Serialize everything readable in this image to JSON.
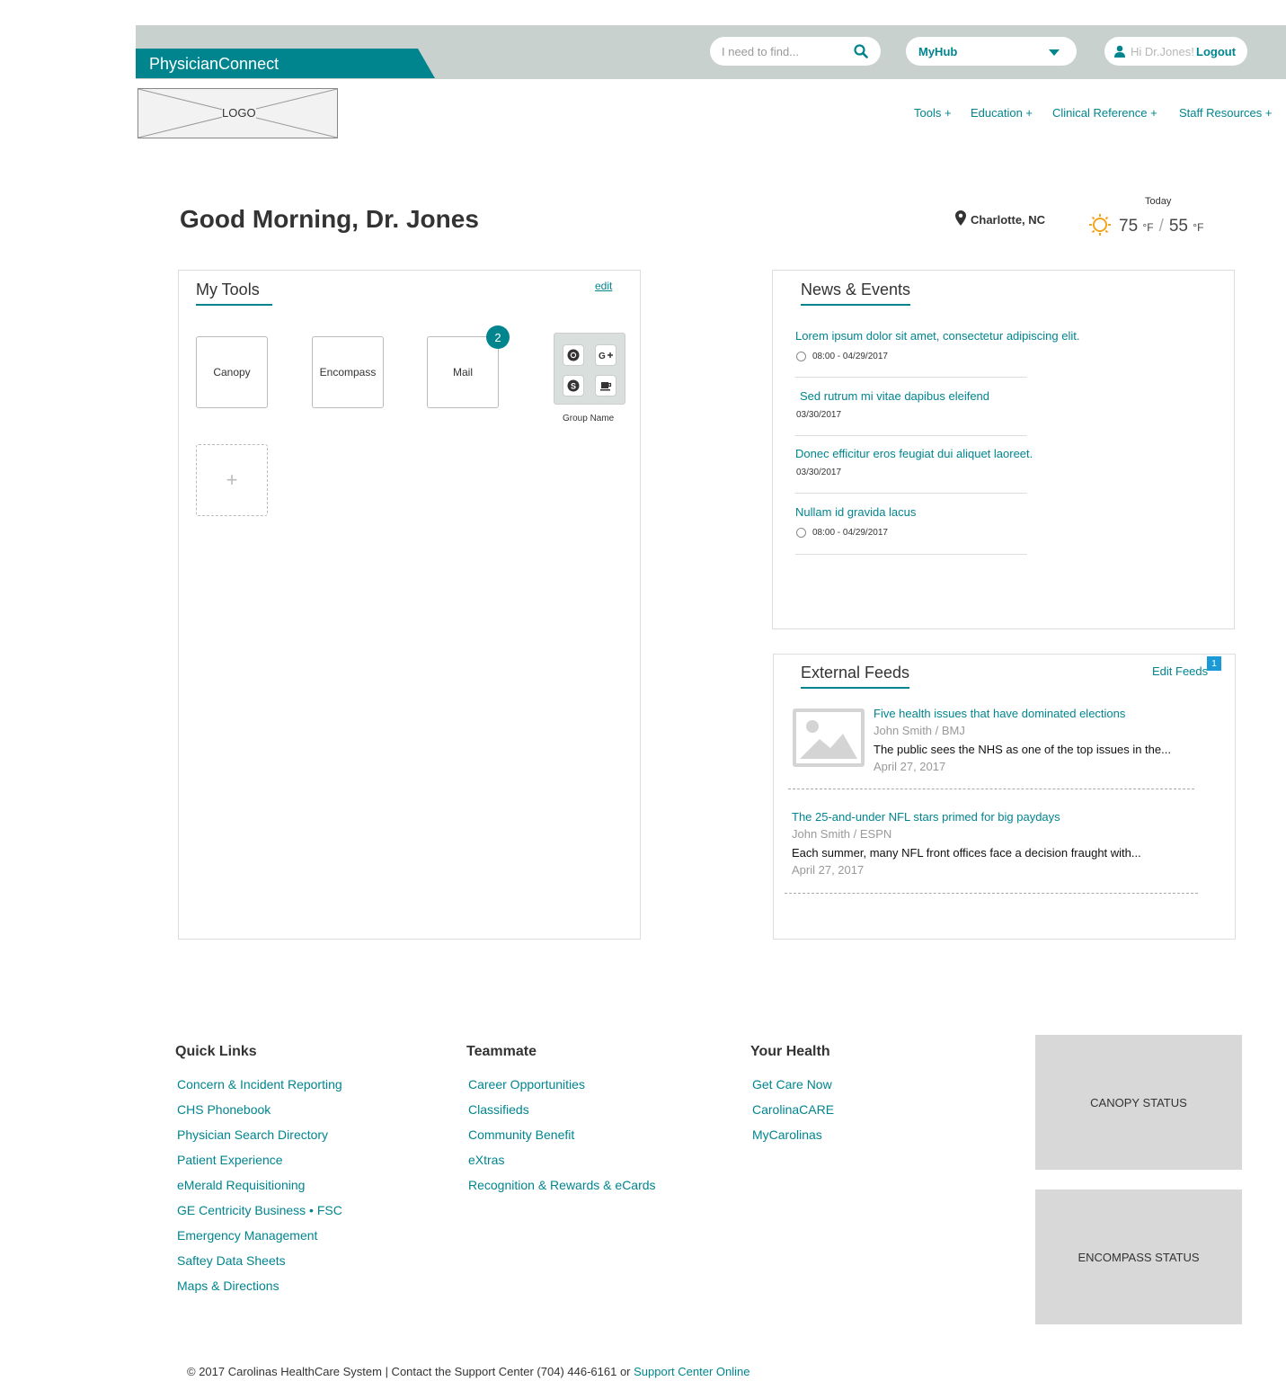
{
  "header": {
    "brand": "PhysicianConnect",
    "search_placeholder": "I need to find...",
    "hub_label": "MyHub",
    "greeting_user": "Hi Dr.Jones!",
    "logout_label": "Logout",
    "logo_text": "LOGO",
    "nav": [
      "Tools +",
      "Education +",
      "Clinical Reference +",
      "Staff Resources +"
    ]
  },
  "greeting": {
    "title": "Good Morning, Dr. Jones",
    "location": "Charlotte, NC",
    "weather_label": "Today",
    "high": "75",
    "low": "55",
    "unit": "°F",
    "separator": "/"
  },
  "my_tools": {
    "title": "My Tools",
    "edit_label": "edit",
    "tiles": [
      "Canopy",
      "Encompass",
      "Mail"
    ],
    "mail_badge": "2",
    "group_name": "Group Name",
    "add_label": "+"
  },
  "news": {
    "title": "News & Events",
    "items": [
      {
        "title": "Lorem ipsum dolor sit amet, consectetur adipiscing elit.",
        "date": "08:00 - 04/29/2017"
      },
      {
        "title": "Sed rutrum mi vitae dapibus eleifend",
        "date": "03/30/2017"
      },
      {
        "title": "Donec efficitur eros feugiat dui aliquet laoreet.",
        "date": "03/30/2017"
      },
      {
        "title": "Nullam id gravida lacus",
        "date": "08:00 - 04/29/2017"
      }
    ]
  },
  "feeds": {
    "title": "External Feeds",
    "edit_label": "Edit Feeds",
    "badge": "1",
    "items": [
      {
        "title": "Five health issues that have dominated elections",
        "source": "John Smith / BMJ",
        "summary": "The public sees the NHS as one of the top issues in the...",
        "date": "April 27, 2017"
      },
      {
        "title": "The 25-and-under NFL stars primed for big paydays",
        "source": "John Smith / ESPN",
        "summary": "Each summer, many NFL front offices face a decision fraught with...",
        "date": "April 27, 2017"
      }
    ]
  },
  "footer": {
    "quick_links": {
      "heading": "Quick Links",
      "links": [
        "Concern & Incident Reporting",
        "CHS Phonebook",
        "Physician Search Directory",
        "Patient Experience",
        "eMerald Requisitioning",
        "GE Centricity Business • FSC",
        "Emergency Management",
        "Saftey Data Sheets",
        "Maps & Directions"
      ]
    },
    "teammate": {
      "heading": "Teammate",
      "links": [
        "Career Opportunities",
        "Classifieds",
        "Community Benefit",
        "eXtras",
        "Recognition & Rewards & eCards"
      ]
    },
    "your_health": {
      "heading": "Your Health",
      "links": [
        "Get Care Now",
        "CarolinaCARE",
        "MyCarolinas"
      ]
    },
    "canopy_status": "CANOPY STATUS",
    "encompass_status": "ENCOMPASS STATUS",
    "copyright": "© 2017 Carolinas HealthCare System | Contact the Support Center (704) 446-6161 or ",
    "support_link": "Support Center Online"
  },
  "colors": {
    "accent": "#00858f",
    "topbar": "#c9d1cf",
    "weather_sun": "#f2a51a",
    "status_box": "#d8d8d8"
  }
}
